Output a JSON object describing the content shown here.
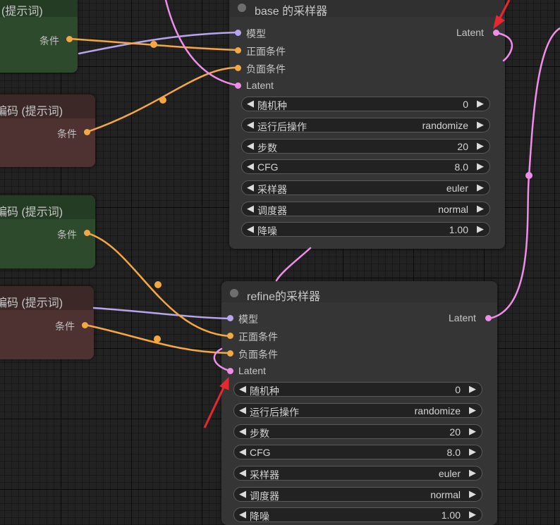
{
  "nodes": {
    "pos_top": {
      "title": "(提示词)",
      "output": "条件"
    },
    "neg_top": {
      "title": "编码 (提示词)",
      "output": "条件"
    },
    "pos_mid": {
      "title": "编码 (提示词)",
      "output": "条件"
    },
    "neg_mid": {
      "title": "编码 (提示词)",
      "output": "条件"
    }
  },
  "samplers": [
    {
      "title": "base 的采样器",
      "inputs": [
        "模型",
        "正面条件",
        "负面条件",
        "Latent"
      ],
      "output": "Latent",
      "widgets": [
        {
          "label": "随机种",
          "value": "0"
        },
        {
          "label": "运行后操作",
          "value": "randomize"
        },
        {
          "label": "步数",
          "value": "20"
        },
        {
          "label": "CFG",
          "value": "8.0"
        },
        {
          "label": "采样器",
          "value": "euler"
        },
        {
          "label": "调度器",
          "value": "normal"
        },
        {
          "label": "降噪",
          "value": "1.00"
        }
      ]
    },
    {
      "title": "refine的采样器",
      "inputs": [
        "模型",
        "正面条件",
        "负面条件",
        "Latent"
      ],
      "output": "Latent",
      "widgets": [
        {
          "label": "随机种",
          "value": "0"
        },
        {
          "label": "运行后操作",
          "value": "randomize"
        },
        {
          "label": "步数",
          "value": "20"
        },
        {
          "label": "CFG",
          "value": "8.0"
        },
        {
          "label": "采样器",
          "value": "euler"
        },
        {
          "label": "调度器",
          "value": "normal"
        },
        {
          "label": "降噪",
          "value": "1.00"
        }
      ]
    }
  ],
  "widget_arrows": {
    "left": "◀",
    "right": "▶"
  },
  "colors": {
    "link_conditioning": "#f5a742",
    "link_latent": "#ef8ee8",
    "link_model": "#b7a6ee",
    "annotation_arrow": "#e8282f"
  },
  "icons": [
    "title-dot-icon",
    "input-slot-icon",
    "output-slot-icon",
    "red-arrow-annotation-icon",
    "decrement-arrow-icon",
    "increment-arrow-icon"
  ]
}
